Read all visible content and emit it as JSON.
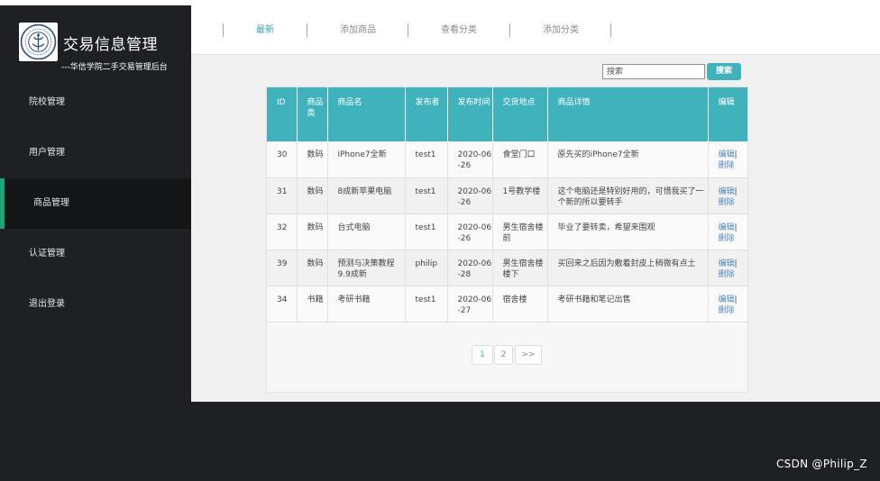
{
  "sidebar": {
    "brand_title": "交易信息管理",
    "brand_subtitle": "---华信学院二手交易管理后台",
    "items": [
      {
        "label": "院校管理"
      },
      {
        "label": "用户管理"
      },
      {
        "label": "商品管理"
      },
      {
        "label": "认证管理"
      },
      {
        "label": "退出登录"
      }
    ],
    "active_index": 2
  },
  "tabs": [
    {
      "label": "最新"
    },
    {
      "label": "添加商品"
    },
    {
      "label": "查看分类"
    },
    {
      "label": "添加分类"
    }
  ],
  "search": {
    "placeholder": "搜索",
    "button_label": "搜索"
  },
  "table": {
    "headers": [
      "ID",
      "商品类",
      "商品名",
      "发布者",
      "发布时间",
      "交货地点",
      "商品详情",
      "编辑"
    ],
    "rows": [
      {
        "id": "30",
        "category": "数码",
        "name": "iPhone7全新",
        "publisher": "test1",
        "date": "2020-06-26",
        "location": "食堂门口",
        "detail": "原先买的iPhone7全新",
        "edit": "编辑",
        "sep": "|",
        "delete": "删除"
      },
      {
        "id": "31",
        "category": "数码",
        "name": "8成新苹果电脑",
        "publisher": "test1",
        "date": "2020-06-26",
        "location": "1号教学楼",
        "detail": "这个电脑还是特别好用的，可惜我买了一个新的所以要转手",
        "edit": "编辑",
        "sep": "|",
        "delete": "删除"
      },
      {
        "id": "32",
        "category": "数码",
        "name": "台式电脑",
        "publisher": "test1",
        "date": "2020-06-26",
        "location": "男生宿舍楼前",
        "detail": "毕业了要转卖，希望来围观",
        "edit": "编辑",
        "sep": "|",
        "delete": "删除"
      },
      {
        "id": "39",
        "category": "数码",
        "name": "预测与决策教程 9.9成新",
        "publisher": "philip",
        "date": "2020-06-28",
        "location": "男生宿舍楼 楼下",
        "detail": "买回来之后因为敷着封皮上稍微有点土",
        "edit": "编辑",
        "sep": "|",
        "delete": "删除"
      },
      {
        "id": "34",
        "category": "书籍",
        "name": "考研书籍",
        "publisher": "test1",
        "date": "2020-06-27",
        "location": "宿舍楼",
        "detail": "考研书籍和笔记出售",
        "edit": "编辑",
        "sep": "|",
        "delete": "删除"
      }
    ]
  },
  "pagination": {
    "pages": [
      "1",
      "2"
    ],
    "next": ">>",
    "current": "1"
  },
  "watermark": "CSDN @Philip_Z",
  "colors": {
    "accent": "#3fb2bc",
    "sidebar_bg": "#1f2024",
    "active_marker": "#1aa37a",
    "link": "#4f88c0"
  }
}
